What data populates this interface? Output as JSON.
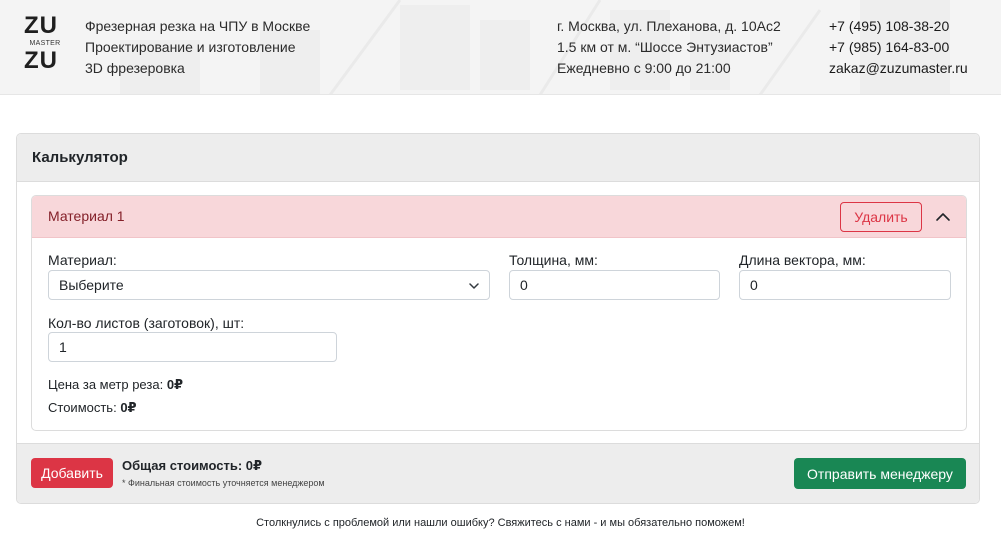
{
  "header": {
    "logo": {
      "top": "ZU",
      "middle": "MASTER",
      "bottom": "ZU"
    },
    "services": [
      "Фрезерная резка на ЧПУ в Москве",
      "Проектирование и изготовление",
      "3D фрезеровка"
    ],
    "address": [
      "г. Москва, ул. Плеханова, д. 10Ас2",
      "1.5 км от м. “Шоссе Энтузиастов”",
      "Ежедневно с 9:00 до 21:00"
    ],
    "contacts": [
      "+7 (495) 108-38-20",
      "+7 (985) 164-83-00",
      "zakaz@zuzumaster.ru"
    ]
  },
  "calculator": {
    "title": "Калькулятор",
    "material_block": {
      "title": "Материал 1",
      "delete_label": "Удалить",
      "collapse_icon": "chevron-up-icon",
      "material_label": "Материал:",
      "material_value": "Выберите",
      "thickness_label": "Толщина, мм:",
      "thickness_value": "0",
      "vector_label": "Длина вектора, мм:",
      "vector_value": "0",
      "sheets_label": "Кол-во листов (заготовок), шт:",
      "sheets_value": "1",
      "price_label": "Цена за метр реза:",
      "price_value": "0₽",
      "cost_label": "Стоимость:",
      "cost_value": "0₽"
    },
    "footer": {
      "add_label": "Добавить",
      "total": "Общая стоимость: 0₽",
      "note": "* Финальная стоимость уточняется менеджером",
      "send_label": "Отправить менеджеру"
    }
  },
  "footer_text": "Столкнулись с проблемой или нашли ошибку? Свяжитесь с нами - и мы обязательно поможем!",
  "colors": {
    "danger": "#dc3545",
    "danger_bg": "#f8d7da",
    "success": "#198754",
    "card_header_bg": "#ededed"
  }
}
